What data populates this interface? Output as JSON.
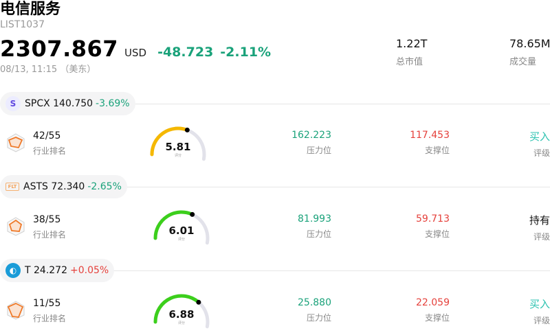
{
  "header": {
    "title": "电信服务",
    "code": "LIST1037",
    "price": "2307.867",
    "currency": "USD",
    "change": "-48.723",
    "change_pct": "-2.11%",
    "timestamp": "08/13, 11:15 （美东）"
  },
  "stats": {
    "market_cap": {
      "value": "1.22T",
      "label": "总市值"
    },
    "volume": {
      "value": "78.65M",
      "label": "成交量"
    }
  },
  "labels": {
    "rank": "行业排名",
    "resistance": "压力位",
    "support": "支撑位",
    "rating": "评级",
    "score_unit": "评分"
  },
  "stocks": [
    {
      "logo_text": "S",
      "ticker_price": "SPCX 140.750",
      "change_pct": "-3.69%",
      "rank": "42/55",
      "score": "5.81",
      "score_fraction": 0.581,
      "score_color": "#f5b800",
      "resistance": "162.223",
      "support": "117.453",
      "rating": "买入"
    },
    {
      "logo_text": "FLT",
      "ticker_price": "ASTS 72.340",
      "change_pct": "-2.65%",
      "rank": "38/55",
      "score": "6.01",
      "score_fraction": 0.601,
      "score_color": "#3ccf1c",
      "resistance": "81.993",
      "support": "59.713",
      "rating": "持有"
    },
    {
      "logo_text": "◐",
      "ticker_price": "T 24.272",
      "change_pct": "+0.05%",
      "rank": "11/55",
      "score": "6.88",
      "score_fraction": 0.688,
      "score_color": "#3ccf1c",
      "resistance": "25.880",
      "support": "22.059",
      "rating": "买入"
    }
  ]
}
